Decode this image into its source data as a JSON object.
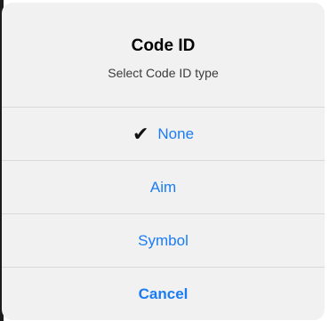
{
  "dialog": {
    "title": "Code ID",
    "subtitle": "Select Code ID type",
    "options": [
      {
        "label": "None",
        "selected": true
      },
      {
        "label": "Aim",
        "selected": false
      },
      {
        "label": "Symbol",
        "selected": false
      }
    ],
    "cancel_label": "Cancel"
  },
  "colors": {
    "accent": "#1a7cf5",
    "sheet_bg": "#f1f1f1",
    "separator": "#d9d9d9"
  },
  "icons": {
    "checkmark": "checkmark-icon"
  }
}
